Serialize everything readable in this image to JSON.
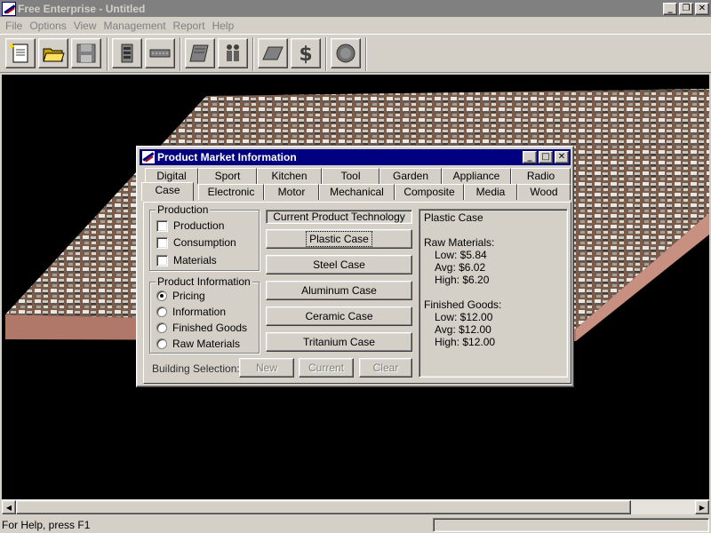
{
  "window": {
    "title": "Free Enterprise - Untitled"
  },
  "menu": [
    "File",
    "Options",
    "View",
    "Management",
    "Report",
    "Help"
  ],
  "status": {
    "help": "For Help, press F1"
  },
  "dialog": {
    "title": "Product Market Information",
    "tabs_back": [
      "Digital",
      "Sport",
      "Kitchen",
      "Tool",
      "Garden",
      "Appliance",
      "Radio"
    ],
    "tabs_front": [
      "Case",
      "Electronic",
      "Motor",
      "Mechanical",
      "Composite",
      "Media",
      "Wood"
    ],
    "active_tab": "Case",
    "production": {
      "label": "Production",
      "options": [
        {
          "label": "Production",
          "checked": false
        },
        {
          "label": "Consumption",
          "checked": false
        },
        {
          "label": "Materials",
          "checked": false
        }
      ]
    },
    "product_info": {
      "label": "Product Information",
      "options": [
        {
          "label": "Pricing",
          "selected": true
        },
        {
          "label": "Information",
          "selected": false
        },
        {
          "label": "Finished Goods",
          "selected": false
        },
        {
          "label": "Raw Materials",
          "selected": false
        }
      ]
    },
    "technology": {
      "header": "Current Product Technology",
      "buttons": [
        "Plastic Case",
        "Steel Case",
        "Aluminum Case",
        "Ceramic Case",
        "Tritanium Case"
      ]
    },
    "building": {
      "label": "Building Selection:",
      "new": "New",
      "current": "Current",
      "clear": "Clear"
    },
    "info": {
      "product": "Plastic Case",
      "raw_header": "Raw Materials:",
      "raw_low": "Low: $5.84",
      "raw_avg": "Avg: $6.02",
      "raw_high": "High: $6.20",
      "fin_header": "Finished Goods:",
      "fin_low": "Low: $12.00",
      "fin_avg": "Avg: $12.00",
      "fin_high": "High: $12.00"
    }
  }
}
